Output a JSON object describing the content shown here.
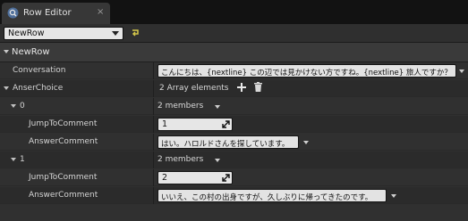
{
  "tab": {
    "title": "Row Editor",
    "close_glyph": "×",
    "icon": "row-editor-icon"
  },
  "toolbar": {
    "row_name": "NewRow",
    "refresh_icon": "refresh-icon"
  },
  "category": {
    "title": "NewRow"
  },
  "rows": {
    "conversation": {
      "label": "Conversation",
      "value": "こんにちは、{nextline} この辺では見かけない方ですね。{nextline} 旅人ですか？"
    },
    "anser_choice": {
      "label": "AnserChoice",
      "summary": "2 Array elements",
      "add_icon": "plus-icon",
      "delete_icon": "trash-icon"
    },
    "element0": {
      "index": "0",
      "summary": "2 members",
      "jump_label": "JumpToComment",
      "jump_value": "1",
      "answer_label": "AnswerComment",
      "answer_value": "はい。ハロルドさんを探しています。"
    },
    "element1": {
      "index": "1",
      "summary": "2 members",
      "jump_label": "JumpToComment",
      "jump_value": "2",
      "answer_label": "AnswerComment",
      "answer_value": "いいえ、この村の出身ですが、久しぶりに帰ってきたのです。"
    }
  },
  "colors": {
    "accent_refresh": "#d6c94a",
    "panel_bg": "#303030",
    "textbox_bg": "#e3e3e3"
  }
}
